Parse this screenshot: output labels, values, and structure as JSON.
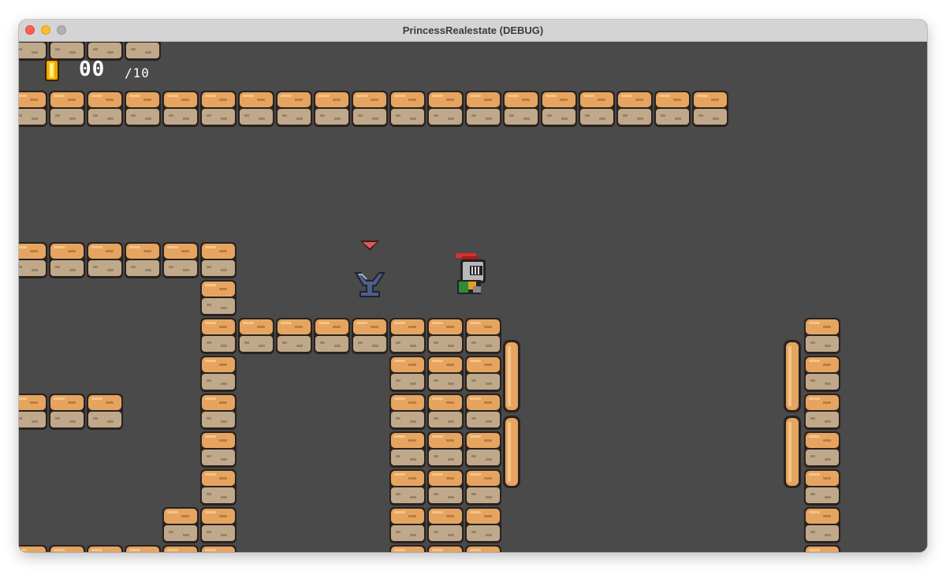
{
  "window": {
    "title": "PrincessRealestate (DEBUG)"
  },
  "hud": {
    "coin_count": "00",
    "coin_total": "/10",
    "coin_icon": "gold-coin-icon"
  },
  "colors": {
    "background": "#4a4a4a",
    "brick_top": "#e5a560",
    "brick_bottom": "#c0a98a",
    "outline": "#2a2220"
  },
  "entities": {
    "player": "knight-red-plume",
    "marker": "red-triangle-marker",
    "pedestal": "blue-pedestal"
  }
}
